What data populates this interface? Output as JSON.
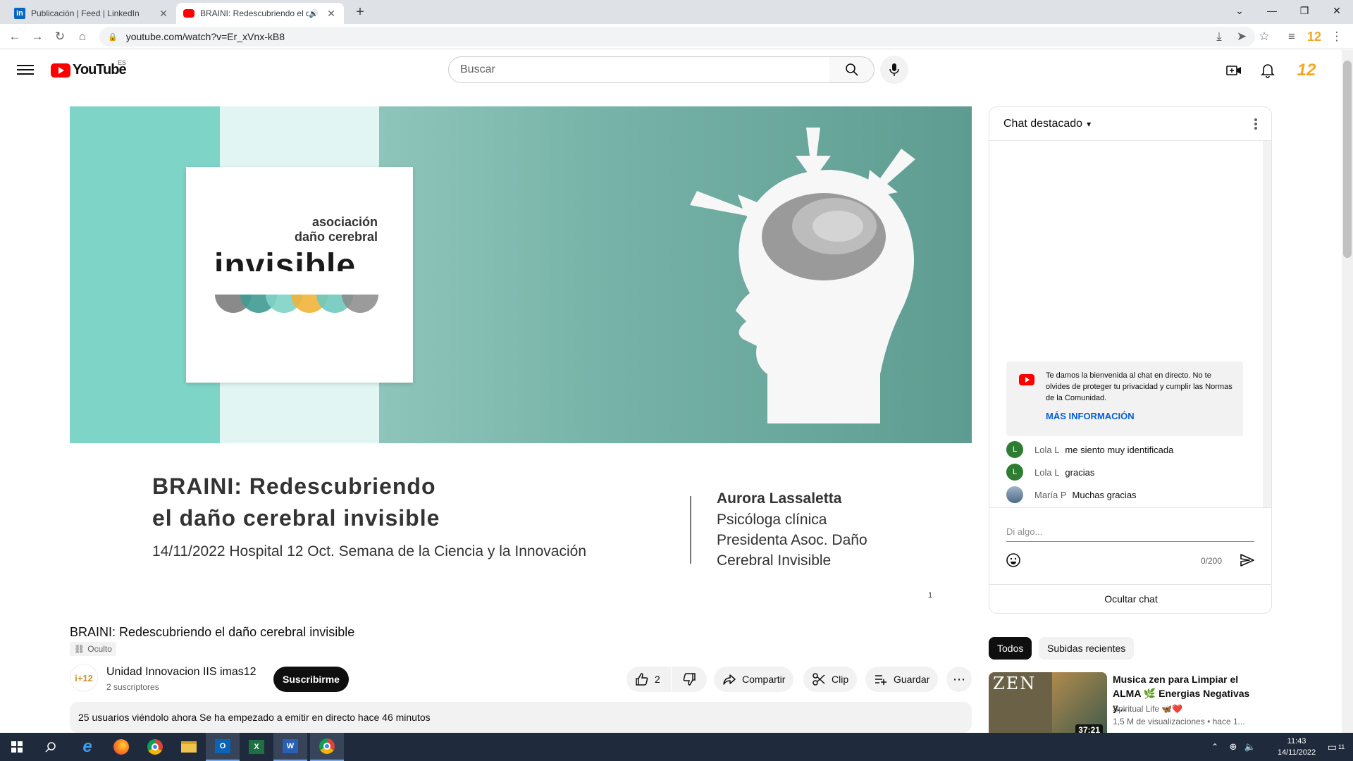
{
  "browser": {
    "tabs": [
      {
        "title": "Publicación | Feed | LinkedIn",
        "icon": "linkedin-icon"
      },
      {
        "title": "BRAINI: Redescubriendo el d",
        "icon": "youtube-icon",
        "audio": "speaker-icon"
      }
    ],
    "url": "youtube.com/watch?v=Er_xVnx-kB8",
    "extension_badge": "12"
  },
  "youtube": {
    "logo_text": "YouTube",
    "country_code": "ES",
    "search_placeholder": "Buscar",
    "account_badge": "12"
  },
  "video": {
    "slide": {
      "logo_line1": "asociación",
      "logo_line2": "daño cerebral",
      "logo_line3": "invisible",
      "title_line1": "BRAINI: Redescubriendo",
      "title_line2": "el daño cerebral invisible",
      "subtitle": "14/11/2022 Hospital 12 Oct. Semana de la Ciencia y la Innovación",
      "speaker_name": "Aurora Lassaletta",
      "speaker_role1": "Psicóloga clínica",
      "speaker_role2": "Presidenta Asoc. Daño",
      "speaker_role3": "Cerebral Invisible",
      "page_number": "1"
    },
    "title": "BRAINI: Redescubriendo el daño cerebral invisible",
    "privacy": "Oculto",
    "channel": {
      "name": "Unidad Innovacion IIS imas12",
      "subscribers": "2 suscriptores",
      "avatar_text": "i+12"
    },
    "subscribe_label": "Suscribirme",
    "likes": "2",
    "share_label": "Compartir",
    "clip_label": "Clip",
    "save_label": "Guardar",
    "description": "25 usuarios viéndolo ahora  Se ha empezado a emitir en directo hace 46 minutos"
  },
  "chat": {
    "header": "Chat destacado",
    "welcome": "Te damos la bienvenida al chat en directo. No te olvides de proteger tu privacidad y cumplir las Normas de la Comunidad.",
    "welcome_link": "MÁS INFORMACIÓN",
    "messages": [
      {
        "initial": "L",
        "author": "Lola L",
        "text": "me siento muy identificada",
        "color": "#2e7d32"
      },
      {
        "initial": "L",
        "author": "Lola L",
        "text": "gracias",
        "color": "#2e7d32"
      },
      {
        "initial": "",
        "author": "María P",
        "text": "Muchas gracias",
        "color": "#6a87a6"
      }
    ],
    "input_placeholder": "Di algo...",
    "counter": "0/200",
    "hide_label": "Ocultar chat"
  },
  "related": {
    "chips": [
      "Todos",
      "Subidas recientes"
    ],
    "video": {
      "thumb_text": "ZEN",
      "duration": "37:21",
      "title": "Musica zen para Limpiar el ALMA 🌿 Energias Negativas y...",
      "channel": "Spiritual Life 🦋❤️",
      "meta": "1,5 M de visualizaciones  • hace 1..."
    }
  },
  "taskbar": {
    "time": "11:43",
    "date": "14/11/2022",
    "notifications": "11"
  }
}
